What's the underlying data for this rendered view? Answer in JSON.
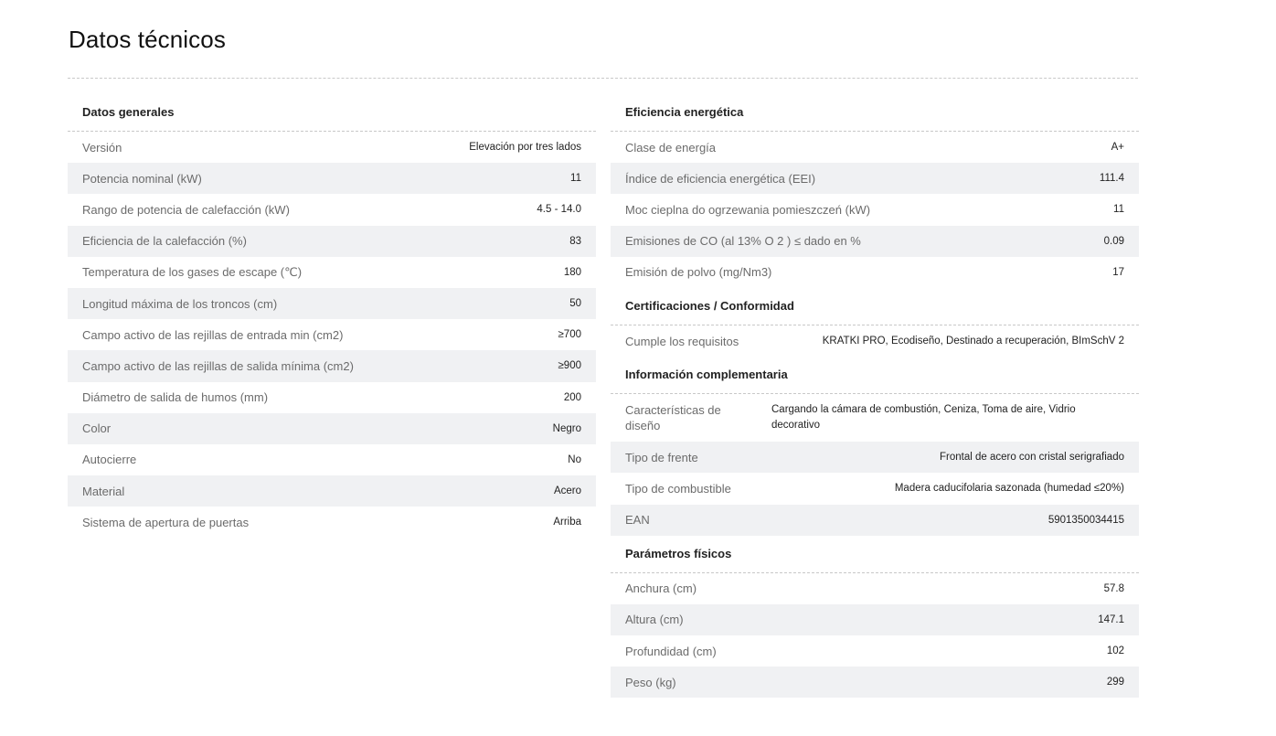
{
  "page": {
    "title": "Datos técnicos"
  },
  "colors": {
    "stripe": "#f0f1f3",
    "label": "#6b6b6b",
    "value": "#222222",
    "divider": "#c8c8c8"
  },
  "left_column": {
    "sections": [
      {
        "title": "Datos generales",
        "rows": [
          {
            "label": "Versión",
            "value": "Elevación por tres lados"
          },
          {
            "label": "Potencia nominal (kW)",
            "value": "11"
          },
          {
            "label": "Rango de potencia de calefacción (kW)",
            "value": "4.5 - 14.0"
          },
          {
            "label": "Eficiencia de la calefacción (%)",
            "value": "83"
          },
          {
            "label": "Temperatura de los gases de escape (℃)",
            "value": "180"
          },
          {
            "label": "Longitud máxima de los troncos (cm)",
            "value": "50"
          },
          {
            "label": "Campo activo de las rejillas de entrada min (cm2)",
            "value": "≥700"
          },
          {
            "label": "Campo activo de las rejillas de salida mínima (cm2)",
            "value": "≥900"
          },
          {
            "label": "Diámetro de salida de humos (mm)",
            "value": "200"
          },
          {
            "label": "Color",
            "value": "Negro"
          },
          {
            "label": "Autocierre",
            "value": "No"
          },
          {
            "label": "Material",
            "value": "Acero"
          },
          {
            "label": "Sistema de apertura de puertas",
            "value": "Arriba"
          }
        ]
      }
    ]
  },
  "right_column": {
    "sections": [
      {
        "title": "Eficiencia energética",
        "rows": [
          {
            "label": "Clase de energía",
            "value": "A+"
          },
          {
            "label": "Índice de eficiencia energética (EEI)",
            "value": "111.4"
          },
          {
            "label": "Moc cieplna do ogrzewania pomieszczeń (kW)",
            "value": "11"
          },
          {
            "label": "Emisiones de CO (al 13% O 2 ) ≤ dado en %",
            "value": "0.09"
          },
          {
            "label": "Emisión de polvo (mg/Nm3)",
            "value": "17"
          }
        ]
      },
      {
        "title": "Certificaciones / Conformidad",
        "rows": [
          {
            "label": "Cumple los requisitos",
            "value": "KRATKI PRO, Ecodiseño, Destinado a recuperación, BImSchV 2"
          }
        ]
      },
      {
        "title": "Información complementaria",
        "rows": [
          {
            "label": "Características de diseño",
            "value": "Cargando la cámara de combustión, Ceniza, Toma de aire, Vidrio decorativo"
          },
          {
            "label": "Tipo de frente",
            "value": "Frontal de acero con cristal serigrafiado"
          },
          {
            "label": "Tipo de combustible",
            "value": "Madera caducifolaria sazonada (humedad ≤20%)"
          },
          {
            "label": "EAN",
            "value": "5901350034415"
          }
        ]
      },
      {
        "title": "Parámetros físicos",
        "rows": [
          {
            "label": "Anchura (cm)",
            "value": "57.8"
          },
          {
            "label": "Altura (cm)",
            "value": "147.1"
          },
          {
            "label": "Profundidad (cm)",
            "value": "102"
          },
          {
            "label": "Peso (kg)",
            "value": "299"
          }
        ]
      }
    ]
  }
}
